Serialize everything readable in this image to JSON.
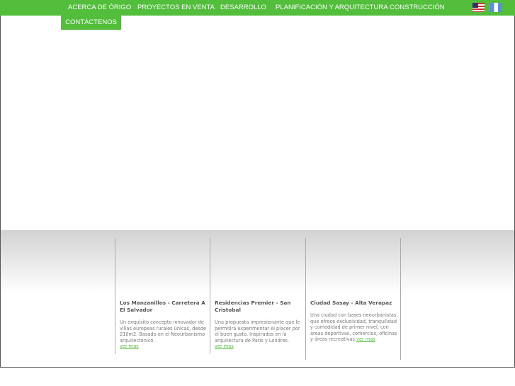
{
  "nav": {
    "items": [
      "ACERCA DE ÓRIGO",
      "PROYECTOS EN VENTA",
      "DESARROLLO",
      "PLANIFICACIÓN Y ARQUITECTURA",
      "CONSTRUCCIÓN"
    ],
    "contact": "CONTÁCTENOS",
    "flags": [
      "us-flag-icon",
      "guatemala-flag-icon"
    ]
  },
  "colors": {
    "accent": "#53bd3c"
  },
  "projects": [
    {
      "title": "Los Manzanillos - Carretera A El Salvador",
      "desc": "Un exquisito concepto innovador de villas europeas rurales únicas, desde 210m2. Basado en el Neourbanismo arquitectónico.",
      "link": "ver mas"
    },
    {
      "title": "Residencias Premier - San Cristobal",
      "desc": "Una propuesta impresionante que le permitirá experimentar el placer por el buen gusto. Inspirados en la arquitectura de Paris y Londres.",
      "link": "ver mas"
    },
    {
      "title": "Ciudad Sasay - Alta Verapaz",
      "desc": "Una ciudad con bases neourbanistas, que ofrece exclusividad, tranquilidad y comodidad de primer nivel, con áreas deportivas, comercios, oficinas y áreas recreativas.",
      "link": "ver mas"
    }
  ]
}
